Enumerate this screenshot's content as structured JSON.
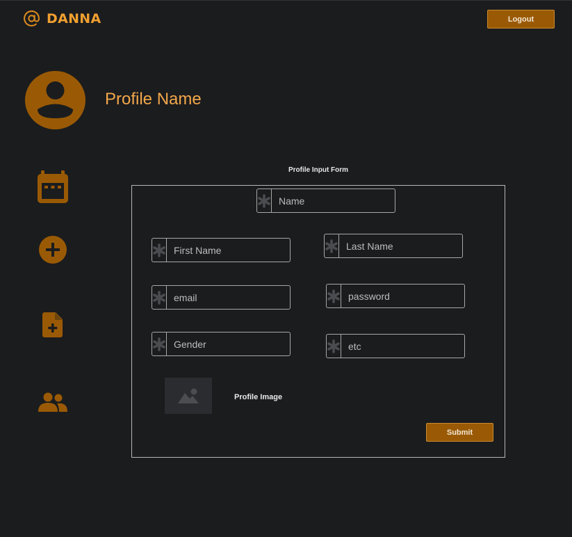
{
  "brand": {
    "name": "DANNA",
    "logo_icon": "at-sign-icon"
  },
  "header": {
    "logout_label": "Logout"
  },
  "profile": {
    "name": "Profile Name",
    "avatar_icon": "user-avatar-icon"
  },
  "sidebar": {
    "items": [
      {
        "icon": "calendar-icon"
      },
      {
        "icon": "add-circle-icon"
      },
      {
        "icon": "add-document-icon"
      },
      {
        "icon": "group-icon"
      }
    ]
  },
  "form": {
    "title": "Profile Input Form",
    "fields": {
      "name": {
        "placeholder": "Name",
        "value": ""
      },
      "first_name": {
        "placeholder": "First Name",
        "value": ""
      },
      "last_name": {
        "placeholder": "Last Name",
        "value": ""
      },
      "email": {
        "placeholder": "email",
        "value": ""
      },
      "password": {
        "placeholder": "password",
        "value": ""
      },
      "gender": {
        "placeholder": "Gender",
        "value": ""
      },
      "etc": {
        "placeholder": "etc",
        "value": ""
      }
    },
    "field_icon": "asterisk-icon",
    "image_label": "Profile Image",
    "image_icon": "image-icon",
    "submit_label": "Submit"
  },
  "colors": {
    "background": "#1b1c1e",
    "accent": "#9a5a05",
    "accent_text": "#f3a84a",
    "field_border": "#a8a8a8"
  }
}
